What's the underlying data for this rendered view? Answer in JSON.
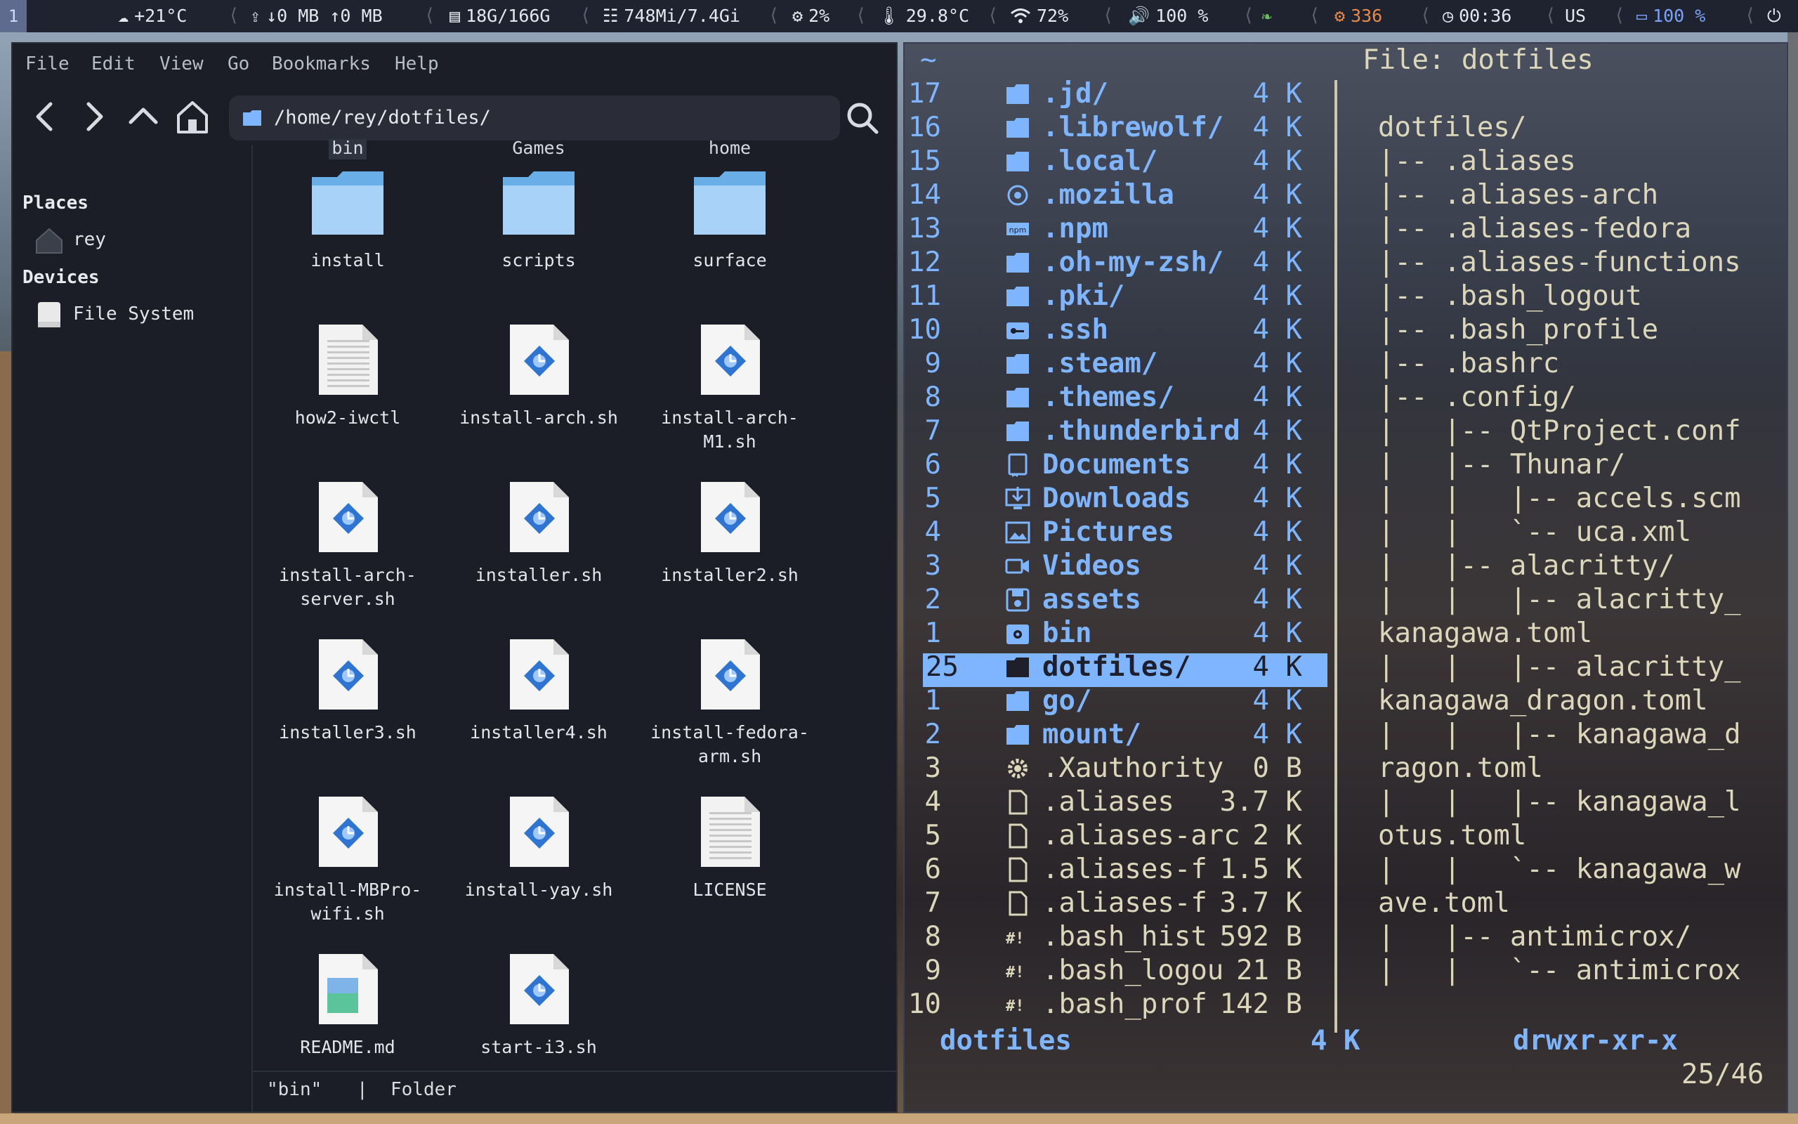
{
  "topbar": {
    "workspace": "1",
    "weather": "+21°C",
    "network": "↓0 MB ↑0 MB",
    "disk": "18G/166G",
    "memory": "748Mi/7.4Gi",
    "cpu": "2%",
    "temperature": "29.8°C",
    "wifi": "72%",
    "volume": "100 %",
    "updates": "336",
    "clock": "00:36",
    "keyboard": "US",
    "battery": "100 %",
    "separator": "⟨"
  },
  "filemanager": {
    "menu": [
      "File",
      "Edit",
      "View",
      "Go",
      "Bookmarks",
      "Help"
    ],
    "path": "/home/rey/dotfiles/",
    "sidebar": {
      "places_heading": "Places",
      "places": [
        "rey"
      ],
      "devices_heading": "Devices",
      "devices": [
        "File System"
      ]
    },
    "top_labels": [
      "bin",
      "Games",
      "home"
    ],
    "items": [
      {
        "name": "install",
        "type": "folder"
      },
      {
        "name": "scripts",
        "type": "folder"
      },
      {
        "name": "surface",
        "type": "folder"
      },
      {
        "name": "how2-iwctl",
        "type": "text"
      },
      {
        "name": "install-arch.sh",
        "type": "script"
      },
      {
        "name": "install-arch-\nM1.sh",
        "type": "script"
      },
      {
        "name": "install-arch-\nserver.sh",
        "type": "script"
      },
      {
        "name": "installer.sh",
        "type": "script"
      },
      {
        "name": "installer2.sh",
        "type": "script"
      },
      {
        "name": "installer3.sh",
        "type": "script"
      },
      {
        "name": "installer4.sh",
        "type": "script"
      },
      {
        "name": "install-fedora-\narm.sh",
        "type": "script"
      },
      {
        "name": "install-MBPro-\nwifi.sh",
        "type": "script"
      },
      {
        "name": "install-yay.sh",
        "type": "script"
      },
      {
        "name": "LICENSE",
        "type": "text"
      },
      {
        "name": "README.md",
        "type": "markdown"
      },
      {
        "name": "start-i3.sh",
        "type": "script"
      }
    ],
    "status": {
      "selected": "\"bin\"",
      "divider": "|",
      "kind": "Folder"
    }
  },
  "terminal": {
    "cwd": "~",
    "preview_title": "File: dotfiles",
    "entries": [
      {
        "n": "17",
        "icon": "folder",
        "name": ".jd/",
        "size": "4 K",
        "kind": "dir"
      },
      {
        "n": "16",
        "icon": "folder",
        "name": ".librewolf/",
        "size": "4 K",
        "kind": "dir"
      },
      {
        "n": "15",
        "icon": "folder",
        "name": ".local/",
        "size": "4 K",
        "kind": "dir"
      },
      {
        "n": "14",
        "icon": "firefox",
        "name": ".mozilla",
        "size": "4 K",
        "kind": "dir"
      },
      {
        "n": "13",
        "icon": "npm",
        "name": ".npm",
        "size": "4 K",
        "kind": "dir"
      },
      {
        "n": "12",
        "icon": "folder",
        "name": ".oh-my-zsh/",
        "size": "4 K",
        "kind": "dir"
      },
      {
        "n": "11",
        "icon": "folder",
        "name": ".pki/",
        "size": "4 K",
        "kind": "dir"
      },
      {
        "n": "10",
        "icon": "key",
        "name": ".ssh",
        "size": "4 K",
        "kind": "dir"
      },
      {
        "n": "9",
        "icon": "folder",
        "name": ".steam/",
        "size": "4 K",
        "kind": "dir"
      },
      {
        "n": "8",
        "icon": "folder",
        "name": ".themes/",
        "size": "4 K",
        "kind": "dir"
      },
      {
        "n": "7",
        "icon": "folder",
        "name": ".thunderbird",
        "size": "4 K",
        "kind": "dir"
      },
      {
        "n": "6",
        "icon": "book",
        "name": "Documents",
        "size": "4 K",
        "kind": "dir"
      },
      {
        "n": "5",
        "icon": "download",
        "name": "Downloads",
        "size": "4 K",
        "kind": "dir"
      },
      {
        "n": "4",
        "icon": "picture",
        "name": "Pictures",
        "size": "4 K",
        "kind": "dir"
      },
      {
        "n": "3",
        "icon": "video",
        "name": "Videos",
        "size": "4 K",
        "kind": "dir"
      },
      {
        "n": "2",
        "icon": "save",
        "name": "assets",
        "size": "4 K",
        "kind": "dir"
      },
      {
        "n": "1",
        "icon": "gear-box",
        "name": "bin",
        "size": "4 K",
        "kind": "dir"
      },
      {
        "n": "25",
        "icon": "folder",
        "name": "dotfiles/",
        "size": "4 K",
        "kind": "selected"
      },
      {
        "n": "1",
        "icon": "folder",
        "name": "go/",
        "size": "4 K",
        "kind": "dir"
      },
      {
        "n": "2",
        "icon": "folder",
        "name": "mount/",
        "size": "4 K",
        "kind": "dir"
      },
      {
        "n": "3",
        "icon": "gear",
        "name": ".Xauthority",
        "size": "0 B",
        "kind": "file"
      },
      {
        "n": "4",
        "icon": "file",
        "name": ".aliases",
        "size": "3.7 K",
        "kind": "file"
      },
      {
        "n": "5",
        "icon": "file",
        "name": ".aliases-arc",
        "size": "2 K",
        "kind": "file"
      },
      {
        "n": "6",
        "icon": "file",
        "name": ".aliases-f",
        "size": "1.5 K",
        "kind": "file"
      },
      {
        "n": "7",
        "icon": "file",
        "name": ".aliases-f",
        "size": "3.7 K",
        "kind": "file"
      },
      {
        "n": "8",
        "icon": "shebang",
        "name": ".bash_hist",
        "size": "592 B",
        "kind": "file"
      },
      {
        "n": "9",
        "icon": "shebang",
        "name": ".bash_logou",
        "size": "21 B",
        "kind": "file"
      },
      {
        "n": "10",
        "icon": "shebang",
        "name": ".bash_prof",
        "size": "142 B",
        "kind": "file"
      }
    ],
    "tree": [
      "dotfiles/",
      "|-- .aliases",
      "|-- .aliases-arch",
      "|-- .aliases-fedora",
      "|-- .aliases-functions",
      "|-- .bash_logout",
      "|-- .bash_profile",
      "|-- .bashrc",
      "|-- .config/",
      "|   |-- QtProject.conf",
      "|   |-- Thunar/",
      "|   |   |-- accels.scm",
      "|   |   `-- uca.xml",
      "|   |-- alacritty/",
      "|   |   |-- alacritty_",
      "kanagawa.toml",
      "|   |   |-- alacritty_",
      "kanagawa_dragon.toml",
      "|   |   |-- kanagawa_d",
      "ragon.toml",
      "|   |   |-- kanagawa_l",
      "otus.toml",
      "|   |   `-- kanagawa_w",
      "ave.toml",
      "|   |-- antimicrox/",
      "|   |   `-- antimicrox"
    ],
    "status": {
      "name": "dotfiles",
      "size": "4 K",
      "perms": "drwxr-xr-x",
      "position": "25/46"
    }
  }
}
